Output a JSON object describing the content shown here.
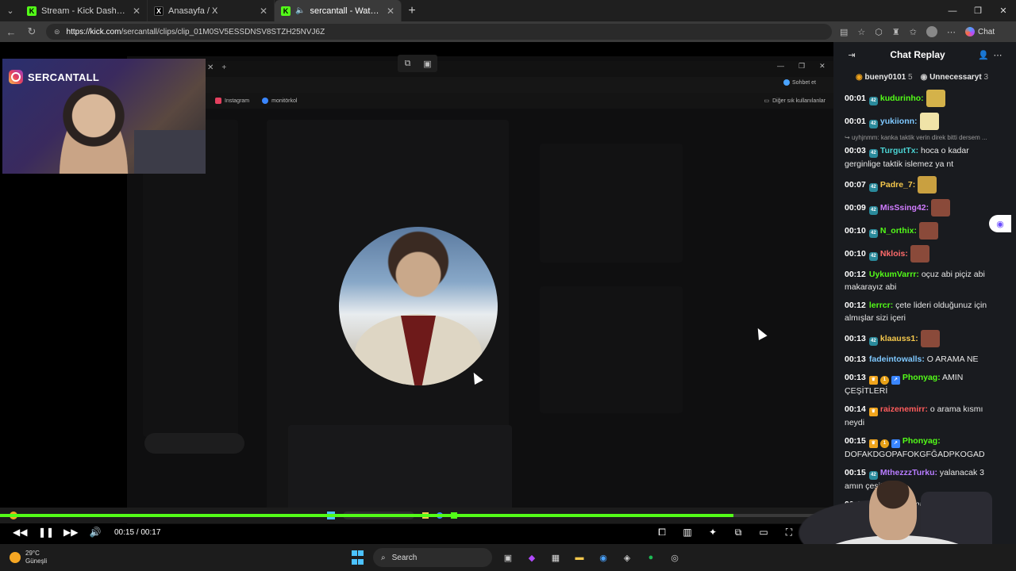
{
  "browser": {
    "tabs": [
      {
        "title": "Stream - Kick Dashboard",
        "favicon": "kick-icon",
        "active": false
      },
      {
        "title": "Anasayfa / X",
        "favicon": "x-icon",
        "active": false
      },
      {
        "title": "sercantall - Watch clips on Kick",
        "favicon": "kick-icon",
        "active": true
      }
    ],
    "url_host": "https://kick.com",
    "url_path": "/sercantall/clips/clip_01M0SV5ESSDNSV8STZH25NVJ6Z",
    "copilot_label": "Chat"
  },
  "video": {
    "cam_label": "SERCANTALL",
    "inner_bookmarks": [
      "Instagram",
      "monitörkol"
    ],
    "inner_bookmark_right": "Diğer sık kullanılanlar",
    "inner_chat_btn": "Sohbet et",
    "current_time": "00:15",
    "duration": "00:17",
    "progress": 0.88
  },
  "chat": {
    "title": "Chat Replay",
    "pinned": [
      {
        "name": "bueny0101",
        "count": "5"
      },
      {
        "name": "Unnecessaryt",
        "count": "3"
      }
    ],
    "messages": [
      {
        "ts": "00:01",
        "badges": [
          "sub"
        ],
        "user": "kudurinho:",
        "color": "#53fc18",
        "text": "",
        "emote": "#d4b24a"
      },
      {
        "ts": "00:01",
        "badges": [
          "sub"
        ],
        "user": "yukiionn:",
        "color": "#7ec8ff",
        "text": "",
        "emote": "#f0e3a8"
      },
      {
        "reply": "uyhjnmm: kanka taktik verin direk bitti dersem ..."
      },
      {
        "ts": "00:03",
        "badges": [
          "sub"
        ],
        "user": "TurgutTx:",
        "color": "#4bd4d4",
        "text": "hoca o kadar gerginlige taktik islemez ya nt"
      },
      {
        "ts": "00:07",
        "badges": [
          "sub"
        ],
        "user": "Padre_7:",
        "color": "#f5c84c",
        "text": "",
        "emote": "#c9a040"
      },
      {
        "ts": "00:09",
        "badges": [
          "sub"
        ],
        "user": "MisSsing42:",
        "color": "#d07cff",
        "text": "",
        "emote": "#8a4a3a"
      },
      {
        "ts": "00:10",
        "badges": [
          "sub"
        ],
        "user": "N_orthix:",
        "color": "#53fc18",
        "text": "",
        "emote": "#8a4a3a"
      },
      {
        "ts": "00:10",
        "badges": [
          "sub"
        ],
        "user": "Nklois:",
        "color": "#ff6b6b",
        "text": "",
        "emote": "#8a4a3a"
      },
      {
        "ts": "00:12",
        "badges": [],
        "user": "UykumVarrr:",
        "color": "#53fc18",
        "text": "oçuz abi piçiz abi makarayız abi"
      },
      {
        "ts": "00:12",
        "badges": [],
        "user": "lerrcr:",
        "color": "#53fc18",
        "text": "çete lideri olduğunuz için almışlar sizi içeri"
      },
      {
        "ts": "00:13",
        "badges": [
          "sub"
        ],
        "user": "klaauss1:",
        "color": "#f5c84c",
        "text": "",
        "emote": "#8a4a3a"
      },
      {
        "ts": "00:13",
        "badges": [],
        "user": "fadeintowalls:",
        "color": "#7ec8ff",
        "text": "O ARAMA NE"
      },
      {
        "ts": "00:13",
        "badges": [
          "crown",
          "coin",
          "boost"
        ],
        "user": "Phonyag:",
        "color": "#53fc18",
        "text": "AMIN ÇEŞİTLERİ"
      },
      {
        "ts": "00:14",
        "badges": [
          "crown"
        ],
        "user": "raizenemirr:",
        "color": "#ff5c5c",
        "text": "o arama kısmı neydi"
      },
      {
        "ts": "00:15",
        "badges": [
          "crown",
          "coin",
          "boost"
        ],
        "user": "Phonyag:",
        "color": "#53fc18",
        "text": "DOFAKDGOPAFOKGFĞADPKOGAD"
      },
      {
        "ts": "00:15",
        "badges": [
          "sub"
        ],
        "user": "MthezzzTurku:",
        "color": "#b77cff",
        "text": "yalanacak 3 amın çeşit"
      },
      {
        "ts": "00:15",
        "badges": [],
        "user": "WaLee:",
        "color": "#53fc18",
        "text": "arama geçmişine ba"
      }
    ]
  },
  "taskbar": {
    "temperature": "29°C",
    "weather": "Güneşli",
    "search_label": "Search"
  },
  "colors": {
    "kick_green": "#53fc18",
    "chat_bg": "#191b1f"
  }
}
